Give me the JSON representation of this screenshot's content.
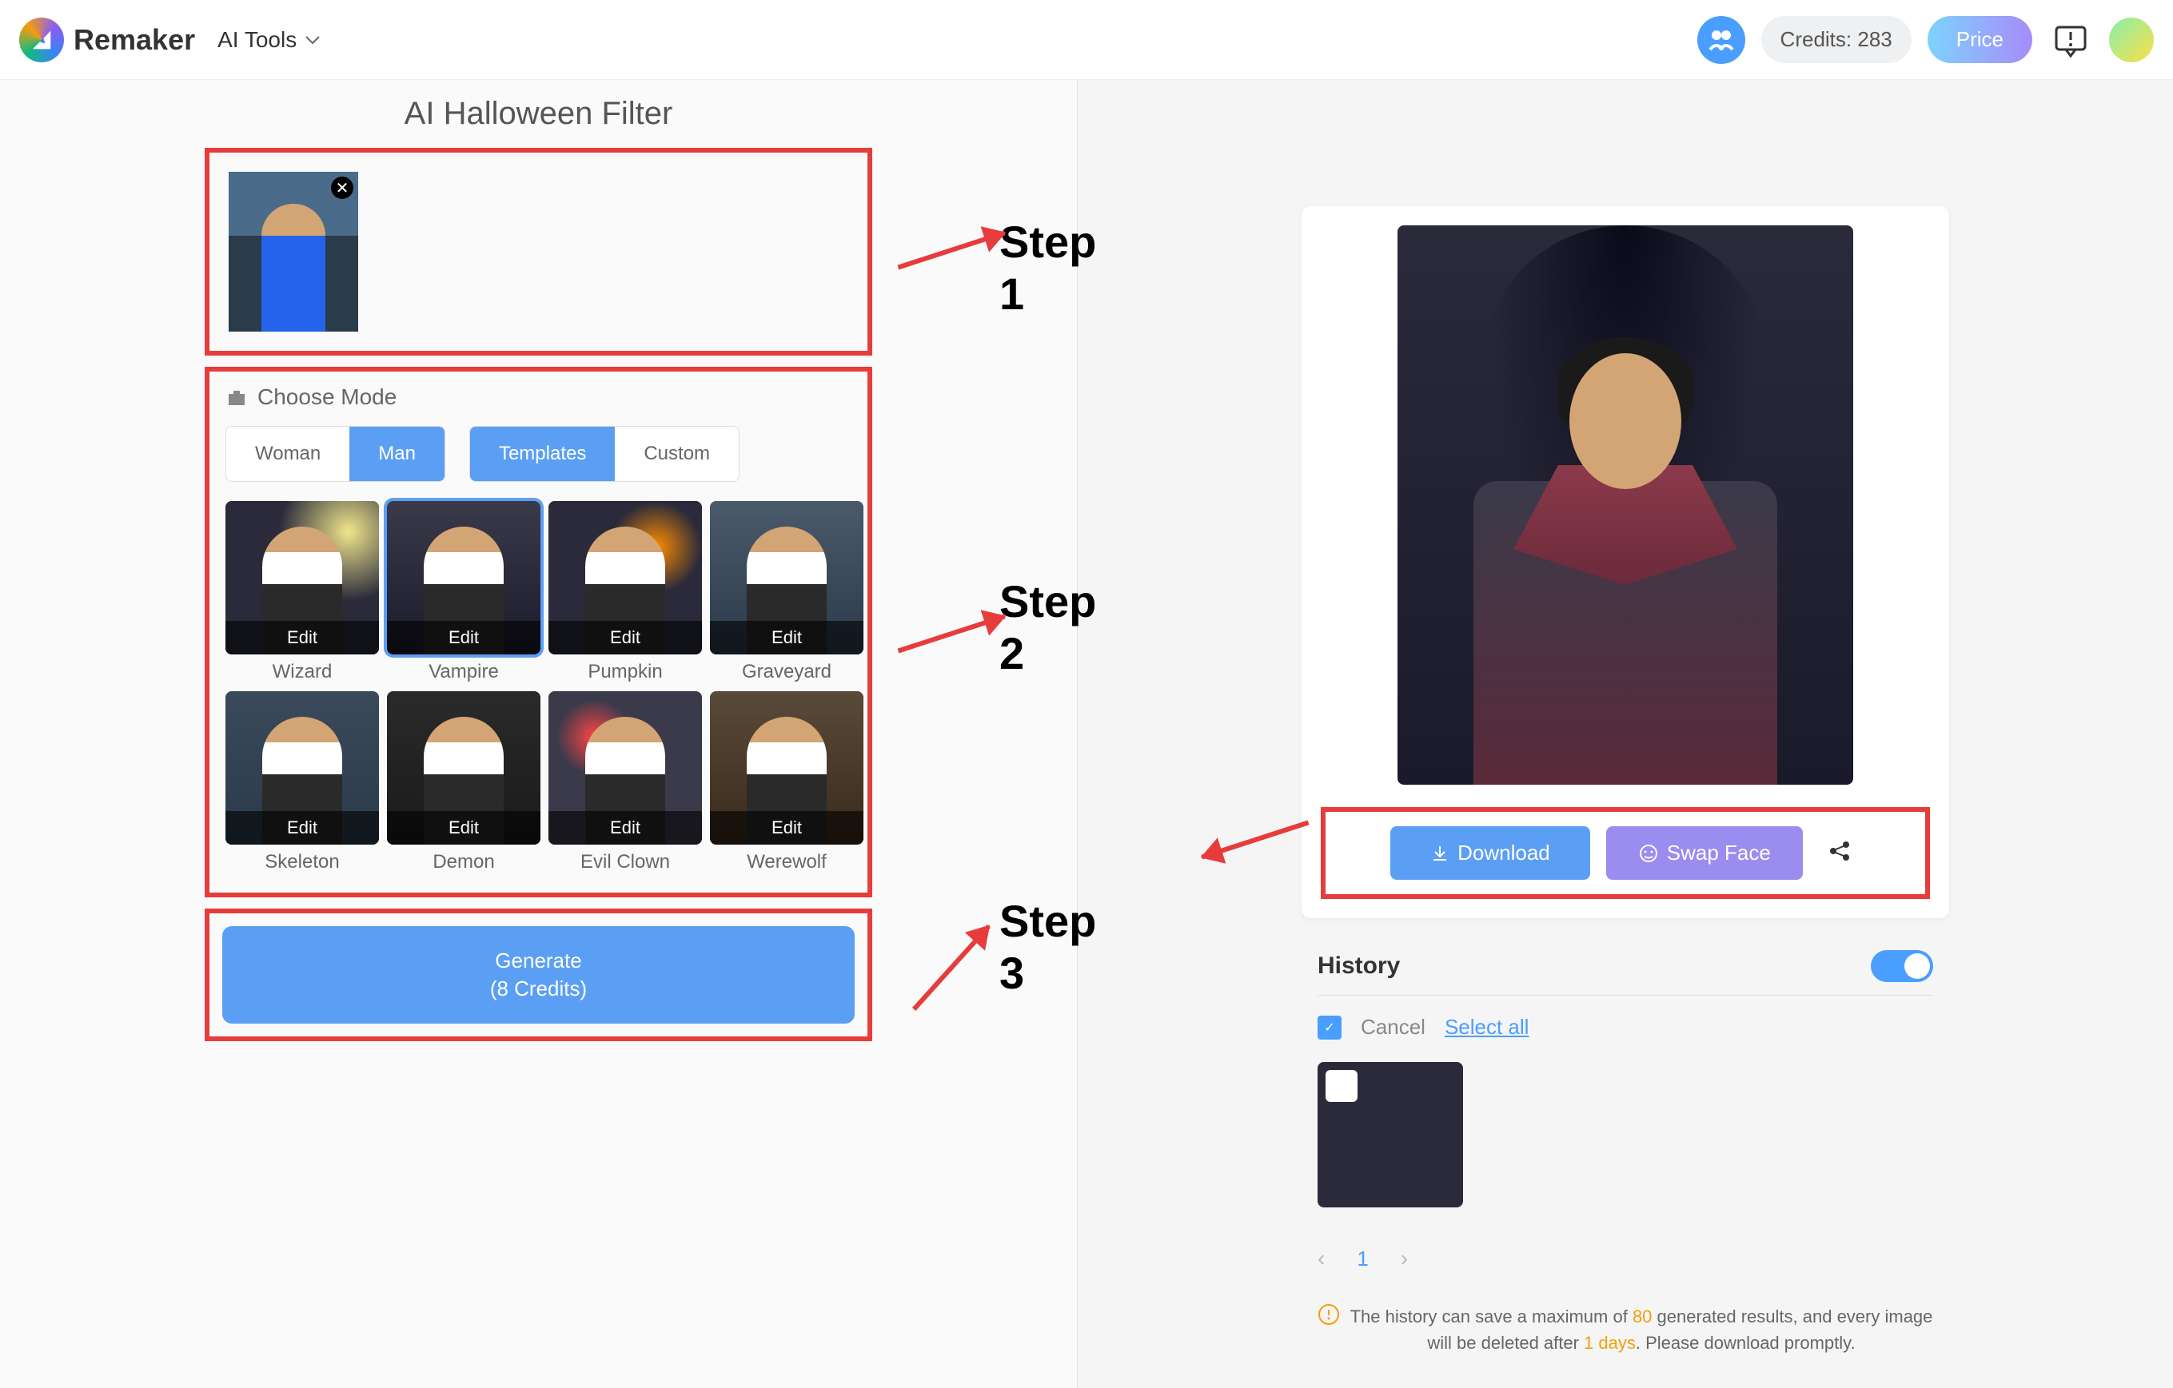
{
  "header": {
    "brand": "Remaker",
    "aiTools": "AI Tools",
    "creditsLabel": "Credits:",
    "creditsValue": "283",
    "priceLabel": "Price"
  },
  "left": {
    "title": "AI Halloween Filter",
    "chooseMode": "Choose Mode",
    "tabs1": {
      "woman": "Woman",
      "man": "Man"
    },
    "tabs2": {
      "templates": "Templates",
      "custom": "Custom"
    },
    "editLabel": "Edit",
    "templates": [
      {
        "name": "Wizard",
        "cls": "wizard"
      },
      {
        "name": "Vampire",
        "cls": "vampire",
        "selected": true
      },
      {
        "name": "Pumpkin",
        "cls": "pumpkin"
      },
      {
        "name": "Graveyard",
        "cls": "graveyard"
      },
      {
        "name": "Skeleton",
        "cls": "skeleton"
      },
      {
        "name": "Demon",
        "cls": "demon"
      },
      {
        "name": "Evil Clown",
        "cls": "clown"
      },
      {
        "name": "Werewolf",
        "cls": "werewolf"
      }
    ],
    "generateLine1": "Generate",
    "generateLine2": "(8 Credits)"
  },
  "steps": {
    "s1": "Step 1",
    "s2": "Step 2",
    "s3": "Step 3"
  },
  "right": {
    "download": "Download",
    "swap": "Swap Face",
    "historyTitle": "History",
    "cancel": "Cancel",
    "selectAll": "Select all",
    "page": "1",
    "noteP1": "The history can save a maximum of ",
    "noteHl1": "80",
    "noteP2": " generated results, and every image will be deleted after ",
    "noteHl2": "1 days",
    "noteP3": ". Please download promptly."
  }
}
